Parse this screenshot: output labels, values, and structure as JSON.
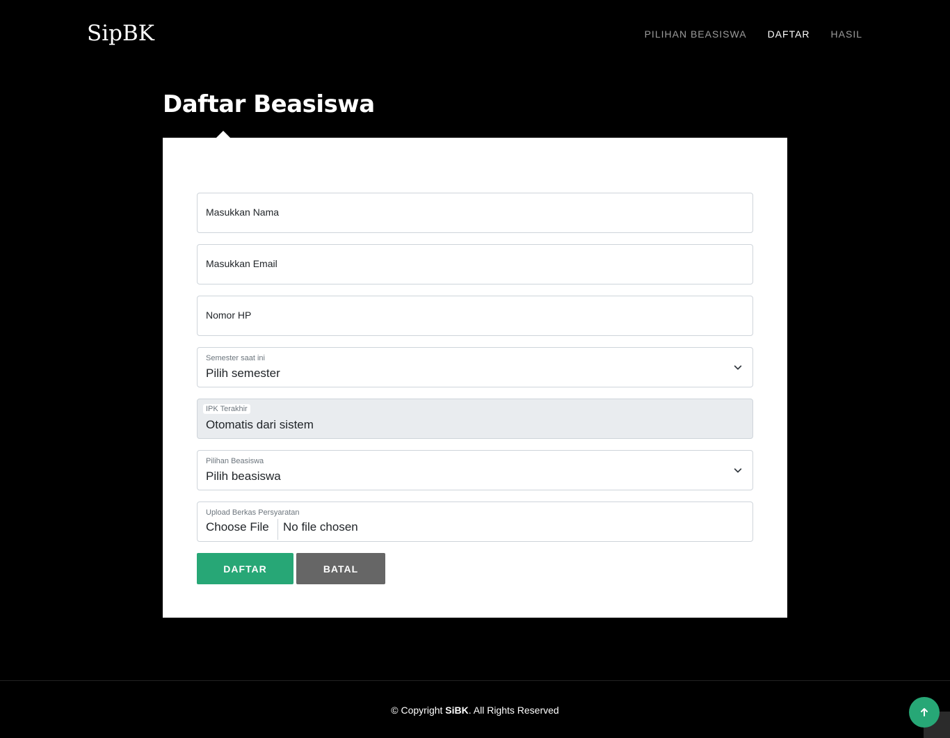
{
  "brand": {
    "logo": "SipBK"
  },
  "nav": {
    "items": [
      {
        "label": "PILIHAN BEASISWA",
        "active": false
      },
      {
        "label": "DAFTAR",
        "active": true
      },
      {
        "label": "HASIL",
        "active": false
      }
    ]
  },
  "page": {
    "title": "Daftar Beasiswa"
  },
  "form": {
    "nama": {
      "placeholder": "Masukkan Nama"
    },
    "email": {
      "placeholder": "Masukkan Email"
    },
    "hp": {
      "placeholder": "Nomor HP"
    },
    "semester": {
      "label": "Semester saat ini",
      "value": "Pilih semester"
    },
    "ipk": {
      "label": "IPK Terakhir",
      "value": "Otomatis dari sistem"
    },
    "beasiswa": {
      "label": "Pilihan Beasiswa",
      "value": "Pilih beasiswa"
    },
    "upload": {
      "label": "Upload Berkas Persyaratan",
      "button": "Choose File",
      "status": "No file chosen"
    },
    "submit_label": "DAFTAR",
    "cancel_label": "BATAL"
  },
  "footer": {
    "copyright_prefix": "© Copyright ",
    "brand": "SiBK",
    "copyright_suffix": ". All Rights Reserved"
  },
  "icons": {
    "chevron": "chevron-down-icon",
    "back_to_top": "arrow-up-icon"
  },
  "colors": {
    "accent": "#27a776",
    "secondary": "#666666",
    "background": "#000000"
  }
}
